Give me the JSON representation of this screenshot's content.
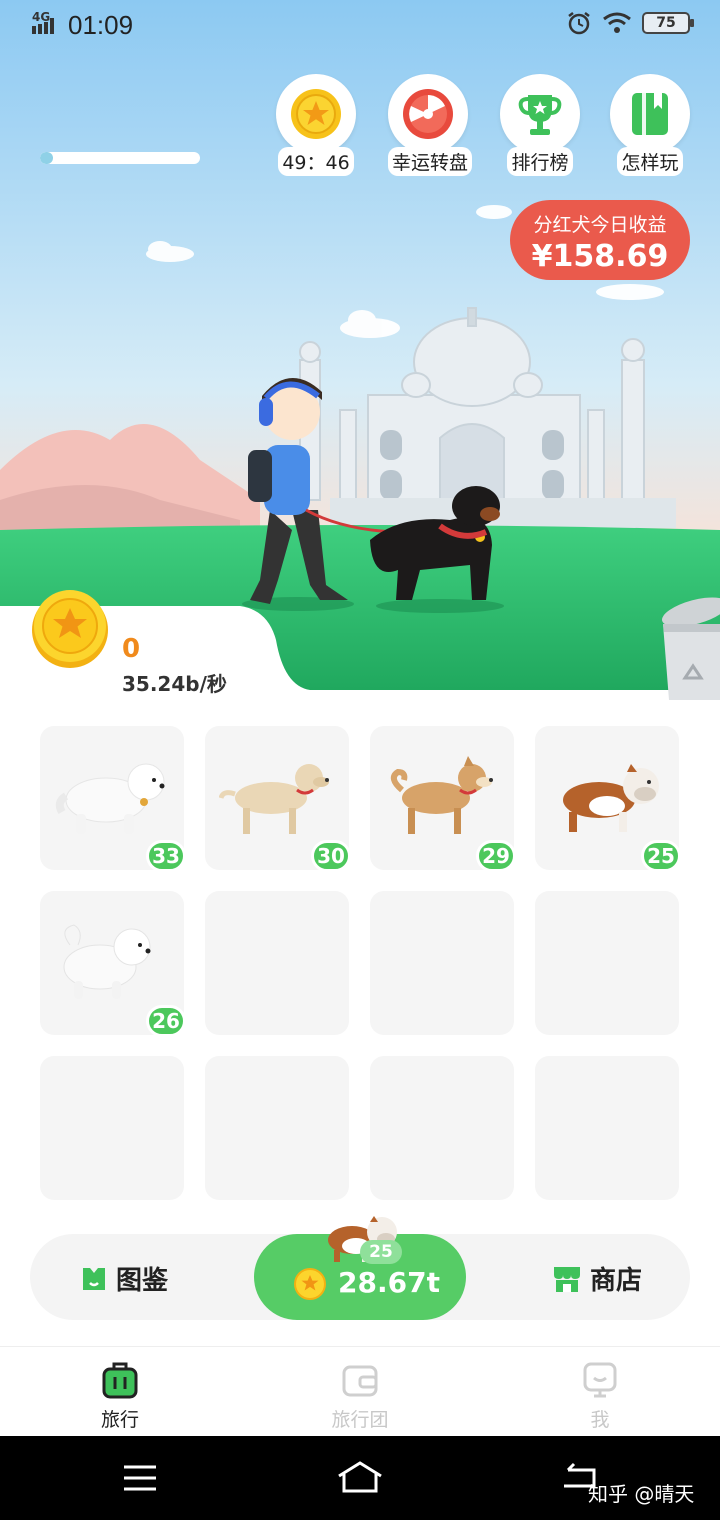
{
  "status_bar": {
    "network": "4G",
    "time": "01:09",
    "battery": "75"
  },
  "progress": {
    "value": 0.08
  },
  "top_buttons": [
    {
      "label": "49：46",
      "icon": "star-coin-icon"
    },
    {
      "label": "幸运转盘",
      "icon": "lucky-wheel-icon"
    },
    {
      "label": "排行榜",
      "icon": "trophy-icon"
    },
    {
      "label": "怎样玩",
      "icon": "book-icon"
    }
  ],
  "dividend": {
    "title": "分红犬今日收益",
    "amount": "¥158.69"
  },
  "coins": {
    "count": "0",
    "rate": "35.24b/秒"
  },
  "dog_slots": [
    {
      "level": "33",
      "breed": "great-pyrenees"
    },
    {
      "level": "30",
      "breed": "labrador"
    },
    {
      "level": "29",
      "breed": "shiba"
    },
    {
      "level": "25",
      "breed": "bulldog"
    },
    {
      "level": "26",
      "breed": "samoyed"
    },
    {
      "level": "",
      "breed": ""
    },
    {
      "level": "",
      "breed": ""
    },
    {
      "level": "",
      "breed": ""
    },
    {
      "level": "",
      "breed": ""
    },
    {
      "level": "",
      "breed": ""
    },
    {
      "level": "",
      "breed": ""
    },
    {
      "level": "",
      "breed": ""
    }
  ],
  "actions": {
    "catalog": "图鉴",
    "buy_level": "25",
    "buy_price": "28.67t",
    "shop": "商店"
  },
  "tabs": [
    {
      "label": "旅行",
      "color": "#222222"
    },
    {
      "label": "旅行团",
      "color": "#c8c8c8"
    },
    {
      "label": "我",
      "color": "#c8c8c8"
    }
  ],
  "watermark": "知乎 @晴天",
  "colors": {
    "accent_green": "#56cc66",
    "dividend_red": "#ea5a4c",
    "coin_orange": "#f08a1c"
  }
}
